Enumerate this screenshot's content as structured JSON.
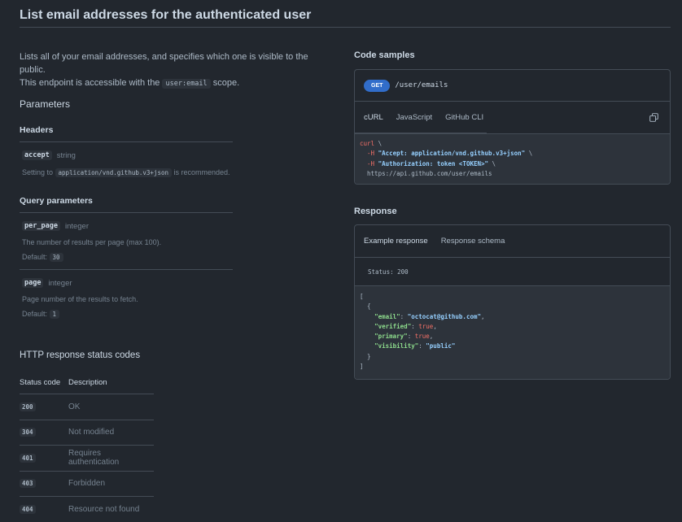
{
  "page": {
    "title": "List email addresses for the authenticated user",
    "intro_line1": "Lists all of your email addresses, and specifies which one is visible to the public.",
    "intro_line2_pre": "This endpoint is accessible with the ",
    "intro_scope": "user:email",
    "intro_line2_post": " scope."
  },
  "params": {
    "heading": "Parameters",
    "headers_heading": "Headers",
    "headers": [
      {
        "name": "accept",
        "type": "string",
        "desc_pre": "Setting to ",
        "desc_code": "application/vnd.github.v3+json",
        "desc_post": " is recommended."
      }
    ],
    "query_heading": "Query parameters",
    "query": [
      {
        "name": "per_page",
        "type": "integer",
        "desc": "The number of results per page (max 100).",
        "default_label": "Default:",
        "default": "30"
      },
      {
        "name": "page",
        "type": "integer",
        "desc": "Page number of the results to fetch.",
        "default_label": "Default:",
        "default": "1"
      }
    ]
  },
  "http_status": {
    "heading": "HTTP response status codes",
    "col_code": "Status code",
    "col_desc": "Description",
    "rows": [
      {
        "code": "200",
        "desc": "OK"
      },
      {
        "code": "304",
        "desc": "Not modified"
      },
      {
        "code": "401",
        "desc": "Requires authentication"
      },
      {
        "code": "403",
        "desc": "Forbidden"
      },
      {
        "code": "404",
        "desc": "Resource not found"
      }
    ]
  },
  "code_samples": {
    "heading": "Code samples",
    "method": "GET",
    "path": "/user/emails",
    "tabs": [
      "cURL",
      "JavaScript",
      "GitHub CLI"
    ],
    "active_tab": "cURL",
    "curl": {
      "cmd": "curl",
      "cont": " \\",
      "flag": "-H",
      "header1": "\"Accept: application/vnd.github.v3+json\"",
      "header2": "\"Authorization: token <TOKEN>\"",
      "url": "https://api.github.com/user/emails"
    }
  },
  "response": {
    "heading": "Response",
    "tabs": [
      "Example response",
      "Response schema"
    ],
    "status": "Status: 200",
    "body": {
      "email_key": "\"email\"",
      "email_val": "\"octocat@github.com\"",
      "verified_key": "\"verified\"",
      "verified_val": "true",
      "primary_key": "\"primary\"",
      "primary_val": "true",
      "visibility_key": "\"visibility\"",
      "visibility_val": "\"public\""
    }
  },
  "icons": {
    "copy": "copy-icon"
  },
  "colors": {
    "background": "#22272e",
    "accent": "#316dca",
    "code_bg": "#2d333b"
  }
}
